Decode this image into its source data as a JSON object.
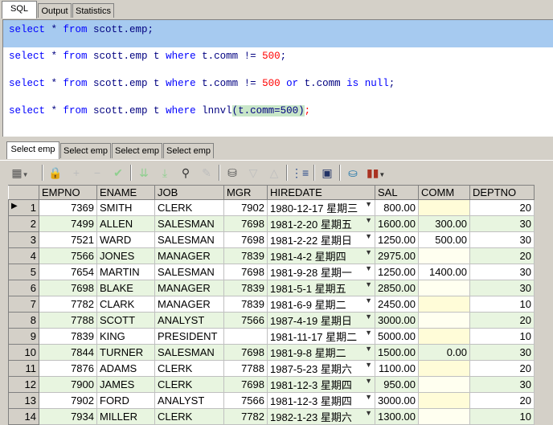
{
  "top_tabs": [
    "SQL",
    "Output",
    "Statistics"
  ],
  "sql": {
    "lines": [
      [
        "select",
        " * ",
        "from",
        " scott.emp;"
      ],
      [
        "select",
        " * ",
        "from",
        " scott.emp t ",
        "where",
        " t.comm != ",
        "500",
        ";"
      ],
      [
        "select",
        " * ",
        "from",
        " scott.emp t ",
        "where",
        " t.comm != ",
        "500",
        " ",
        "or",
        " t.comm ",
        "is",
        " ",
        "null",
        ";"
      ],
      [
        "select",
        " * ",
        "from",
        " scott.emp t ",
        "where",
        " lnnvl",
        "(t.comm=500)",
        ";"
      ]
    ]
  },
  "result_tabs": [
    "Select emp",
    "Select emp",
    "Select emp",
    "Select emp"
  ],
  "toolbar_icons": [
    "grid-view-icon",
    "lock-icon",
    "add-record-icon",
    "delete-record-icon",
    "post-icon",
    "fetch-next-icon",
    "fetch-last-icon",
    "find-icon",
    "clear-icon",
    "query-by-example-icon",
    "filter-down-icon",
    "filter-up-icon",
    "tree-icon",
    "save-icon",
    "export-icon",
    "chart-icon"
  ],
  "grid": {
    "columns": [
      "",
      "EMPNO",
      "ENAME",
      "JOB",
      "MGR",
      "HIREDATE",
      "SAL",
      "COMM",
      "DEPTNO"
    ],
    "rows": [
      [
        "1",
        "7369",
        "SMITH",
        "CLERK",
        "7902",
        "1980-12-17 星期三",
        "800.00",
        "",
        "20"
      ],
      [
        "2",
        "7499",
        "ALLEN",
        "SALESMAN",
        "7698",
        "1981-2-20 星期五",
        "1600.00",
        "300.00",
        "30"
      ],
      [
        "3",
        "7521",
        "WARD",
        "SALESMAN",
        "7698",
        "1981-2-22 星期日",
        "1250.00",
        "500.00",
        "30"
      ],
      [
        "4",
        "7566",
        "JONES",
        "MANAGER",
        "7839",
        "1981-4-2 星期四",
        "2975.00",
        "",
        "20"
      ],
      [
        "5",
        "7654",
        "MARTIN",
        "SALESMAN",
        "7698",
        "1981-9-28 星期一",
        "1250.00",
        "1400.00",
        "30"
      ],
      [
        "6",
        "7698",
        "BLAKE",
        "MANAGER",
        "7839",
        "1981-5-1 星期五",
        "2850.00",
        "",
        "30"
      ],
      [
        "7",
        "7782",
        "CLARK",
        "MANAGER",
        "7839",
        "1981-6-9 星期二",
        "2450.00",
        "",
        "10"
      ],
      [
        "8",
        "7788",
        "SCOTT",
        "ANALYST",
        "7566",
        "1987-4-19 星期日",
        "3000.00",
        "",
        "20"
      ],
      [
        "9",
        "7839",
        "KING",
        "PRESIDENT",
        "",
        "1981-11-17 星期二",
        "5000.00",
        "",
        "10"
      ],
      [
        "10",
        "7844",
        "TURNER",
        "SALESMAN",
        "7698",
        "1981-9-8 星期二",
        "1500.00",
        "0.00",
        "30"
      ],
      [
        "11",
        "7876",
        "ADAMS",
        "CLERK",
        "7788",
        "1987-5-23 星期六",
        "1100.00",
        "",
        "20"
      ],
      [
        "12",
        "7900",
        "JAMES",
        "CLERK",
        "7698",
        "1981-12-3 星期四",
        "950.00",
        "",
        "30"
      ],
      [
        "13",
        "7902",
        "FORD",
        "ANALYST",
        "7566",
        "1981-12-3 星期四",
        "3000.00",
        "",
        "20"
      ],
      [
        "14",
        "7934",
        "MILLER",
        "CLERK",
        "7782",
        "1982-1-23 星期六",
        "1300.00",
        "",
        "10"
      ]
    ]
  }
}
